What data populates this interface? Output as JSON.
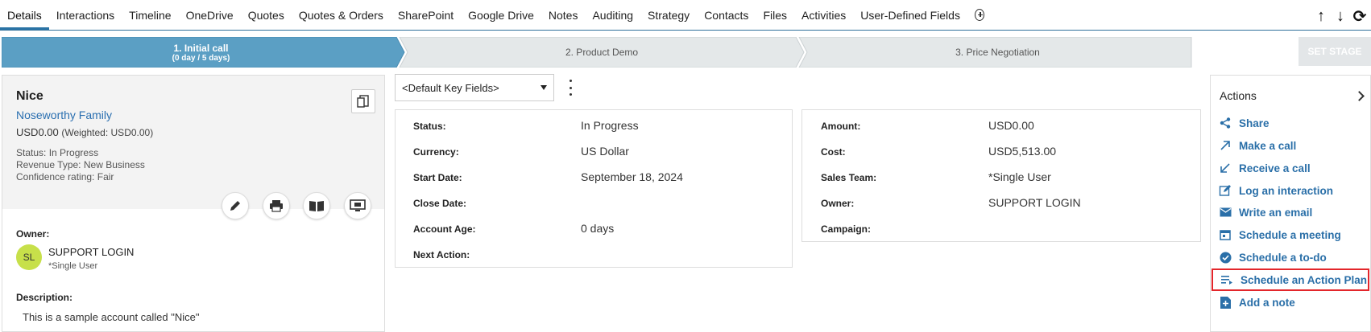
{
  "tabs": [
    "Details",
    "Interactions",
    "Timeline",
    "OneDrive",
    "Quotes",
    "Quotes & Orders",
    "SharePoint",
    "Google Drive",
    "Notes",
    "Auditing",
    "Strategy",
    "Contacts",
    "Files",
    "Activities",
    "User-Defined Fields"
  ],
  "active_tab": "Details",
  "top_actions": {
    "up": "↑",
    "down": "↓",
    "refresh": "⟳"
  },
  "stages": [
    {
      "label": "1. Initial call",
      "sub": "(0 day / 5 days)"
    },
    {
      "label": "2. Product Demo",
      "sub": ""
    },
    {
      "label": "3. Price Negotiation",
      "sub": ""
    }
  ],
  "set_stage_label": "SET STAGE",
  "colors": {
    "active_stage": "#5b9fc4",
    "inactive_stage": "#e4e8e9",
    "link": "#2a6fa8",
    "avatar": "#c7e04a",
    "highlight": "#e3262b"
  },
  "record": {
    "name": "Nice",
    "family": "Noseworthy Family",
    "amount": "USD0.00",
    "weighted": "(Weighted: USD0.00)",
    "status_label": "Status:",
    "status_value": "In Progress",
    "revenue_label": "Revenue Type:",
    "revenue_value": "New Business",
    "confidence_label": "Confidence rating:",
    "confidence_value": "Fair"
  },
  "owner": {
    "label": "Owner:",
    "initials": "SL",
    "name": "SUPPORT LOGIN",
    "team": "*Single User"
  },
  "description": {
    "label": "Description:",
    "text": "This is a sample account called \"Nice\""
  },
  "key_fields": {
    "selected": "<Default Key Fields>"
  },
  "fields_left": [
    {
      "label": "Status:",
      "value": "In Progress"
    },
    {
      "label": "Currency:",
      "value": "US Dollar"
    },
    {
      "label": "Start Date:",
      "value": "September 18, 2024"
    },
    {
      "label": "Close Date:",
      "value": ""
    },
    {
      "label": "Account Age:",
      "value": "0 days"
    },
    {
      "label": "Next Action:",
      "value": ""
    }
  ],
  "fields_right": [
    {
      "label": "Amount:",
      "value": "USD0.00"
    },
    {
      "label": "Cost:",
      "value": "USD5,513.00"
    },
    {
      "label": "Sales Team:",
      "value": "*Single User"
    },
    {
      "label": "Owner:",
      "value": "SUPPORT LOGIN"
    },
    {
      "label": "Campaign:",
      "value": ""
    }
  ],
  "actions": {
    "title": "Actions",
    "items": [
      {
        "label": "Share",
        "icon": "share-icon"
      },
      {
        "label": "Make a call",
        "icon": "outgoing-call-icon"
      },
      {
        "label": "Receive a call",
        "icon": "incoming-call-icon"
      },
      {
        "label": "Log an interaction",
        "icon": "edit-note-icon"
      },
      {
        "label": "Write an email",
        "icon": "email-icon"
      },
      {
        "label": "Schedule a meeting",
        "icon": "calendar-icon"
      },
      {
        "label": "Schedule a to-do",
        "icon": "check-circle-icon"
      },
      {
        "label": "Schedule an Action Plan",
        "icon": "playlist-icon"
      },
      {
        "label": "Add a note",
        "icon": "note-add-icon"
      }
    ]
  }
}
